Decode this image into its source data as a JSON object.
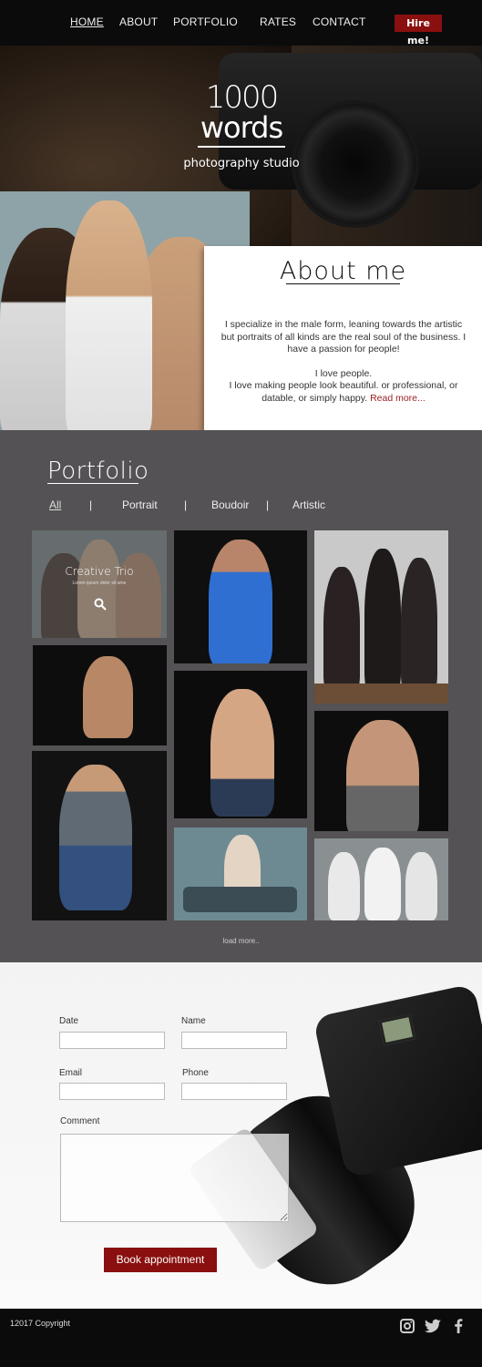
{
  "nav": {
    "items": [
      {
        "label": "HOME",
        "active": true
      },
      {
        "label": "ABOUT",
        "active": false
      },
      {
        "label": "PORTFOLIO",
        "active": false
      },
      {
        "label": "RATES",
        "active": false
      },
      {
        "label": "CONTACT",
        "active": false
      }
    ],
    "cta": "Hire me!"
  },
  "hero": {
    "logo_top": "1000",
    "logo_bottom": "words",
    "tagline": "photography studio"
  },
  "about": {
    "title": "About me",
    "paragraph1": "I specialize in the male form, leaning towards the artistic but portraits of all kinds are the real soul of the business.  I have a passion for people!",
    "paragraph2a": "I love people.",
    "paragraph2b": "I love making people look beautiful. or professional, or datable, or simply happy.",
    "read_more": "Read more..."
  },
  "portfolio": {
    "title": "Portfolio",
    "filters": [
      "All",
      "Portrait",
      "Boudoir",
      "Artistic"
    ],
    "active_filter": "All",
    "separator": "|",
    "featured": {
      "title": "Creative Trio",
      "subtitle": "Lorem ipsum dolor sit ame"
    },
    "load_more": "load more.."
  },
  "booking": {
    "date_label": "Date",
    "name_label": "Name",
    "email_label": "Email",
    "phone_label": "Phone",
    "comment_label": "Comment",
    "date_value": "",
    "name_value": "",
    "email_value": "",
    "phone_value": "",
    "comment_value": "",
    "button": "Book appointment"
  },
  "footer": {
    "copyright": "12017 Copyright",
    "social": [
      "instagram-icon",
      "twitter-icon",
      "facebook-icon"
    ]
  },
  "colors": {
    "accent": "#8a0f0f",
    "nav_bg": "#0b0b0b",
    "portfolio_bg": "#545254"
  }
}
